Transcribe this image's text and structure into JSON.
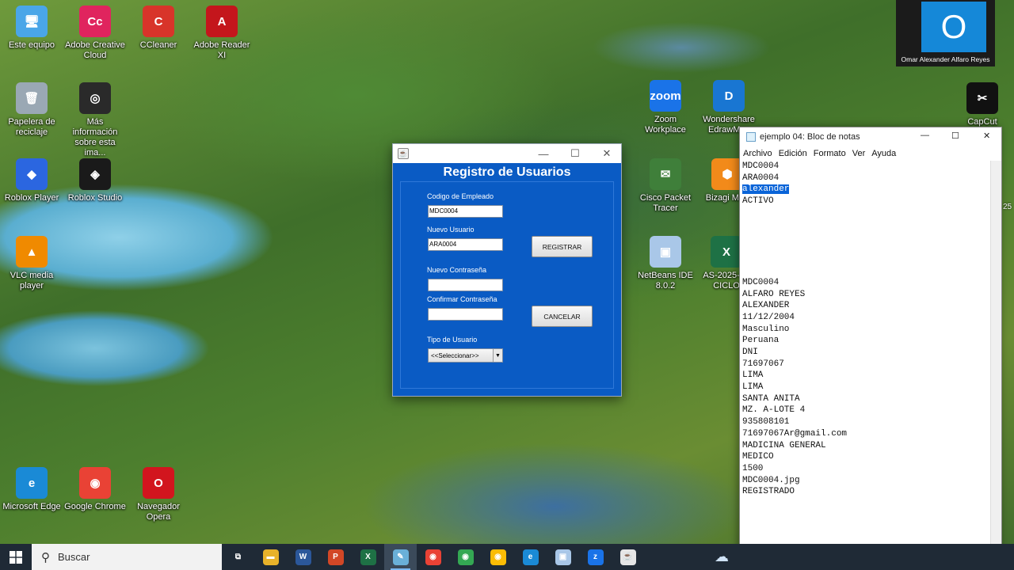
{
  "desktop": {
    "icons": [
      {
        "label": "Este equipo",
        "icon": "computer-icon",
        "color": "#4aa6e8",
        "glyph": "🖥"
      },
      {
        "label": "Adobe Creative Cloud",
        "icon": "creative-cloud-icon",
        "color": "#e0245e",
        "glyph": "Cc"
      },
      {
        "label": "CCleaner",
        "icon": "ccleaner-icon",
        "color": "#d8342a",
        "glyph": "C"
      },
      {
        "label": "Adobe Reader XI",
        "icon": "adobe-reader-icon",
        "color": "#c4161c",
        "glyph": "A"
      },
      {
        "label": "Papelera de reciclaje",
        "icon": "recycle-bin-icon",
        "color": "#9aa8b4",
        "glyph": "🗑"
      },
      {
        "label": "Más información sobre esta ima...",
        "icon": "info-camera-icon",
        "color": "#2a2a2a",
        "glyph": "◎"
      },
      {
        "label": "Roblox Player",
        "icon": "roblox-player-icon",
        "color": "#2b66e0",
        "glyph": "◆"
      },
      {
        "label": "Roblox Studio",
        "icon": "roblox-studio-icon",
        "color": "#1a1a1a",
        "glyph": "◈"
      },
      {
        "label": "VLC media player",
        "icon": "vlc-icon",
        "color": "#f08a00",
        "glyph": "▲"
      },
      {
        "label": "Zoom Workplace",
        "icon": "zoom-icon",
        "color": "#1a73e8",
        "glyph": "zoom"
      },
      {
        "label": "Wondershare EdrawMax",
        "icon": "edrawmax-icon",
        "color": "#1976d2",
        "glyph": "D"
      },
      {
        "label": "CapCut",
        "icon": "capcut-icon",
        "color": "#111111",
        "glyph": "✂"
      },
      {
        "label": "Cisco Packet Tracer",
        "icon": "packet-tracer-icon",
        "color": "#3f7f3a",
        "glyph": "✉"
      },
      {
        "label": "Bizagi Mod",
        "icon": "bizagi-icon",
        "color": "#f28a1a",
        "glyph": "⬢"
      },
      {
        "label": "NetBeans IDE 8.0.2",
        "icon": "netbeans-icon",
        "color": "#a9c7e8",
        "glyph": "▣"
      },
      {
        "label": "AS-2025-I-1 CICLO",
        "icon": "excel-file-icon",
        "color": "#1e7145",
        "glyph": "X"
      },
      {
        "label": "Microsoft Edge",
        "icon": "edge-icon",
        "color": "#1a8ad6",
        "glyph": "e"
      },
      {
        "label": "Google Chrome",
        "icon": "chrome-icon",
        "color": "#e94235",
        "glyph": "◉"
      },
      {
        "label": "Navegador Opera",
        "icon": "opera-icon",
        "color": "#d2151e",
        "glyph": "O"
      }
    ],
    "edge_fragment": "25"
  },
  "registro_window": {
    "heading": "Registro de Usuarios",
    "fields": {
      "codigo_label": "Codigo de Empleado",
      "codigo_value": "MDC0004",
      "usuario_label": "Nuevo Usuario",
      "usuario_value": "ARA0004",
      "contrasena_label": "Nuevo Contraseña",
      "contrasena_value": "",
      "confirmar_label": "Confirmar Contraseña",
      "confirmar_value": "",
      "tipo_label": "Tipo de Usuario",
      "tipo_selected": "<<Seleccionar>>"
    },
    "buttons": {
      "registrar": "REGISTRAR",
      "cancelar": "CANCELAR"
    },
    "colors": {
      "panel": "#0a5bc4"
    }
  },
  "notepad": {
    "title": "ejemplo 04: Bloc de notas",
    "menu": [
      "Archivo",
      "Edición",
      "Formato",
      "Ver",
      "Ayuda"
    ],
    "lines": [
      "MDC0004",
      "ARA0004",
      "alexander",
      "ACTIVO",
      "",
      "",
      "",
      "",
      "",
      "",
      "MDC0004",
      "ALFARO REYES",
      "ALEXANDER",
      "11/12/2004",
      "Masculino",
      "Peruana",
      "DNI",
      "71697067",
      "LIMA",
      "LIMA",
      "SANTA ANITA",
      "MZ. A-LOTE 4",
      "935808101",
      "71697067Ar@gmail.com",
      "MADICINA GENERAL",
      "MEDICO",
      "1500",
      "MDC0004.jpg",
      "REGISTRADO"
    ],
    "selected_line_index": 2
  },
  "teams_tile": {
    "initial": "O",
    "name": "Omar Alexander Alfaro Reyes"
  },
  "taskbar": {
    "search_placeholder": "Buscar",
    "apps": [
      {
        "name": "task-view",
        "glyph": "⧉",
        "color": "transparent"
      },
      {
        "name": "file-explorer",
        "glyph": "▬",
        "color": "#e8b22a"
      },
      {
        "name": "word",
        "glyph": "W",
        "color": "#2b579a"
      },
      {
        "name": "powerpoint",
        "glyph": "P",
        "color": "#d24726"
      },
      {
        "name": "excel",
        "glyph": "X",
        "color": "#1e7145"
      },
      {
        "name": "notepad",
        "glyph": "✎",
        "color": "#6ab0d8"
      },
      {
        "name": "chrome-1",
        "glyph": "◉",
        "color": "#e94235"
      },
      {
        "name": "chrome-2",
        "glyph": "◉",
        "color": "#34a853"
      },
      {
        "name": "chrome-3",
        "glyph": "◉",
        "color": "#fbbc05"
      },
      {
        "name": "edge",
        "glyph": "e",
        "color": "#1a8ad6"
      },
      {
        "name": "netbeans",
        "glyph": "▣",
        "color": "#a9c7e8"
      },
      {
        "name": "zoom",
        "glyph": "z",
        "color": "#1a73e8"
      },
      {
        "name": "java",
        "glyph": "☕",
        "color": "#e6e6e6"
      }
    ],
    "active_app_index": 5
  }
}
